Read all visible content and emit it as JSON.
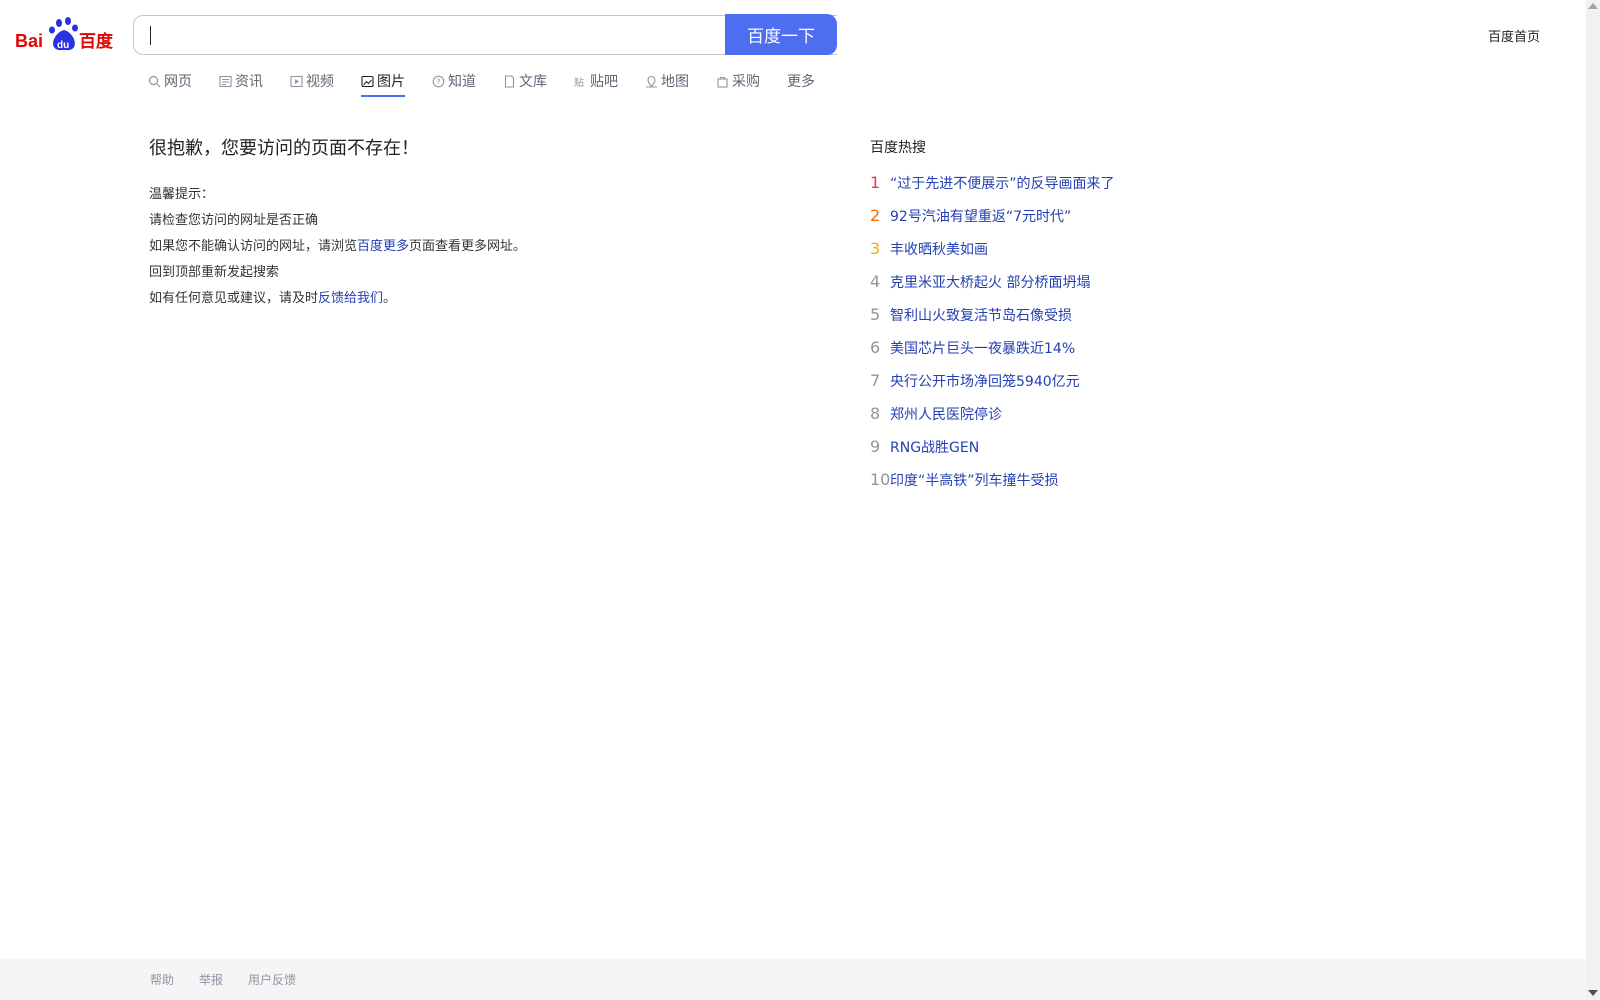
{
  "header": {
    "logo_text": "Bai du 百度",
    "search_value": "",
    "search_button_label": "百度一下",
    "home_link_label": "百度首页"
  },
  "tabs": [
    {
      "label": "网页",
      "icon": "search-icon"
    },
    {
      "label": "资讯",
      "icon": "news-icon"
    },
    {
      "label": "视频",
      "icon": "video-icon"
    },
    {
      "label": "图片",
      "icon": "image-icon",
      "active": true
    },
    {
      "label": "知道",
      "icon": "question-icon"
    },
    {
      "label": "文库",
      "icon": "document-icon"
    },
    {
      "label": "贴吧",
      "icon": "tieba-icon"
    },
    {
      "label": "地图",
      "icon": "map-icon"
    },
    {
      "label": "采购",
      "icon": "shopping-icon"
    },
    {
      "label": "更多"
    }
  ],
  "main": {
    "error_title": "很抱歉，您要访问的页面不存在！",
    "tip_heading": "温馨提示：",
    "tip_check_url": "请检查您访问的网址是否正确",
    "tip_browse_prefix": "如果您不能确认访问的网址，请浏览",
    "tip_browse_link": "百度更多",
    "tip_browse_suffix": "页面查看更多网址。",
    "tip_back_to_top": "回到顶部重新发起搜索",
    "tip_feedback_prefix": "如有任何意见或建议，请及时",
    "tip_feedback_link": "反馈给我们",
    "tip_feedback_suffix": "。"
  },
  "hot_search": {
    "title": "百度热搜",
    "items": [
      {
        "rank": "1",
        "text": "“过于先进不便展示”的反导画面来了"
      },
      {
        "rank": "2",
        "text": "92号汽油有望重返“7元时代”"
      },
      {
        "rank": "3",
        "text": "丰收晒秋美如画"
      },
      {
        "rank": "4",
        "text": "克里米亚大桥起火 部分桥面坍塌"
      },
      {
        "rank": "5",
        "text": "智利山火致复活节岛石像受损"
      },
      {
        "rank": "6",
        "text": "美国芯片巨头一夜暴跌近14%"
      },
      {
        "rank": "7",
        "text": "央行公开市场净回笼5940亿元"
      },
      {
        "rank": "8",
        "text": "郑州人民医院停诊"
      },
      {
        "rank": "9",
        "text": "RNG战胜GEN"
      },
      {
        "rank": "10",
        "text": "印度“半高铁”列车撞牛受损"
      }
    ]
  },
  "footer": {
    "links": [
      "帮助",
      "举报",
      "用户反馈"
    ]
  },
  "colors": {
    "brand_blue": "#4e6ef2",
    "link_blue": "#2440b3",
    "logo_red": "#e10602",
    "rank1": "#f63051",
    "rank2": "#ff6600",
    "rank3": "#faa90e"
  }
}
